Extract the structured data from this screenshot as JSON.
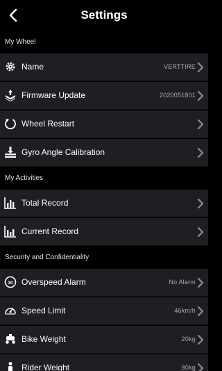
{
  "header": {
    "title": "Settings",
    "back_icon": "chevron-left-icon"
  },
  "sections": {
    "my_wheel": "My Wheel",
    "my_activities": "My Activities",
    "security": "Security and Confidentiality"
  },
  "rows": {
    "name": {
      "label": "Name",
      "value": "VERTTIRE",
      "icon": "gear-icon"
    },
    "firmware": {
      "label": "Firmware Update",
      "value": "2020051801",
      "icon": "download-tray-icon"
    },
    "restart": {
      "label": "Wheel Restart",
      "value": "",
      "icon": "restart-icon"
    },
    "gyro": {
      "label": "Gyro Angle Calibration",
      "value": "",
      "icon": "calibration-icon"
    },
    "total_record": {
      "label": "Total Record",
      "value": "",
      "icon": "bar-chart-icon"
    },
    "current_record": {
      "label": "Current Record",
      "value": "",
      "icon": "bar-chart-icon"
    },
    "overspeed": {
      "label": "Overspeed Alarm",
      "value": "No Alarm",
      "icon": "speed-alarm-icon"
    },
    "speed_limit": {
      "label": "Speed Limit",
      "value": "46km/h",
      "icon": "speedometer-icon"
    },
    "bike_weight": {
      "label": "Bike Weight",
      "value": "20kg",
      "icon": "scooter-icon"
    },
    "rider_weight": {
      "label": "Rider Weight",
      "value": "80kg",
      "icon": "person-icon"
    }
  },
  "colors": {
    "background": "#000000",
    "row": "#1e1f23",
    "value_text": "#a9aaae"
  }
}
